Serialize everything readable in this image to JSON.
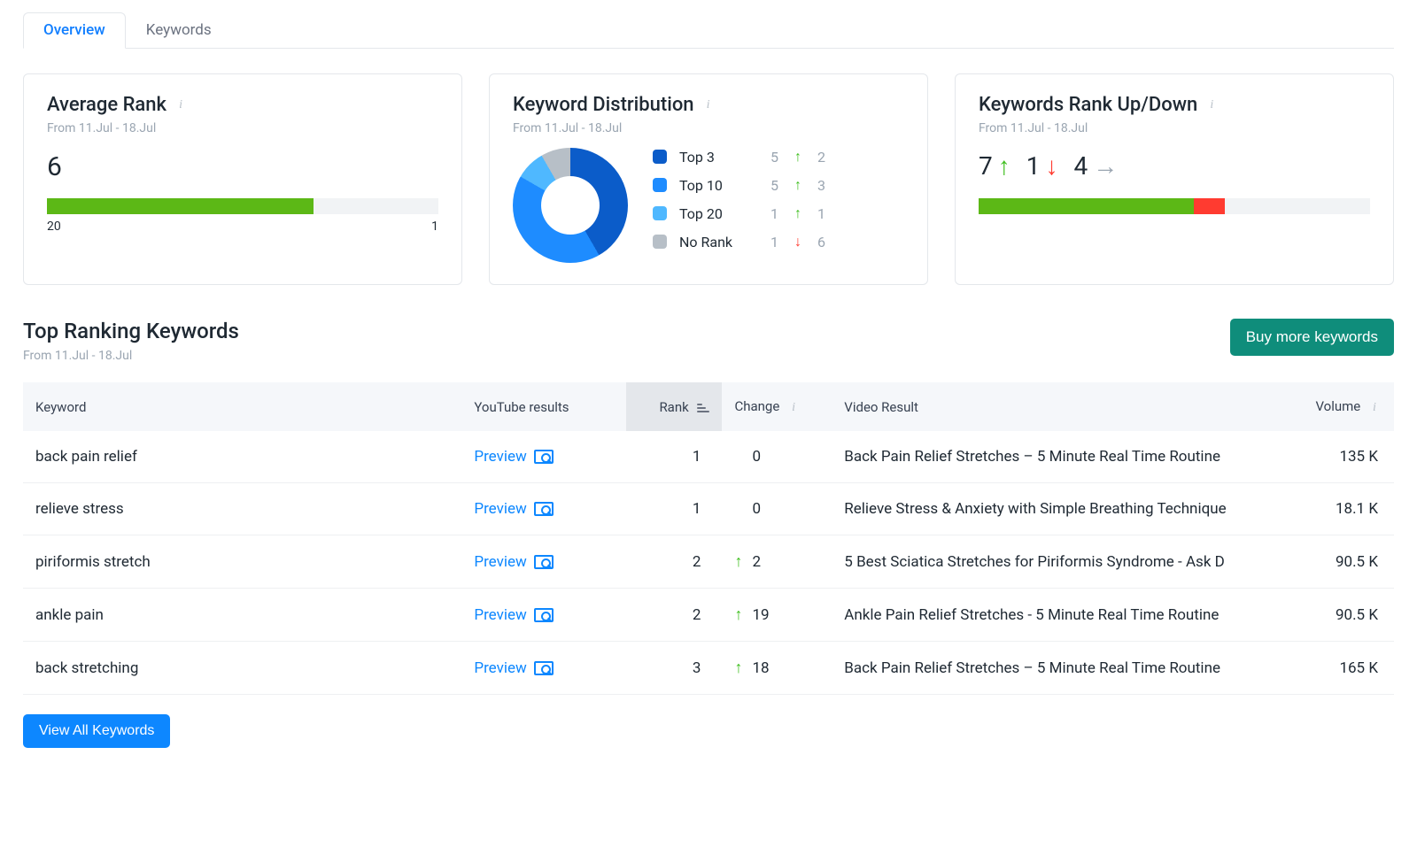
{
  "tabs": {
    "overview": "Overview",
    "keywords": "Keywords"
  },
  "date_range": "From 11.Jul - 18.Jul",
  "cards": {
    "avg_rank": {
      "title": "Average Rank",
      "value": "6",
      "bar_pct": 68,
      "left": "20",
      "right": "1"
    },
    "distribution": {
      "title": "Keyword Distribution",
      "rows": [
        {
          "label": "Top 3",
          "color": "#0b5cc9",
          "count": "5",
          "dir": "up",
          "delta": "2"
        },
        {
          "label": "Top 10",
          "color": "#1e8cff",
          "count": "5",
          "dir": "up",
          "delta": "3"
        },
        {
          "label": "Top 20",
          "color": "#4fb8ff",
          "count": "1",
          "dir": "up",
          "delta": "1"
        },
        {
          "label": "No Rank",
          "color": "#b7bfc7",
          "count": "1",
          "dir": "down",
          "delta": "6"
        }
      ]
    },
    "rank_updown": {
      "title": "Keywords Rank Up/Down",
      "up": "7",
      "down": "1",
      "same": "4",
      "bar": {
        "green": 55,
        "red": 8
      }
    }
  },
  "chart_data": {
    "type": "pie",
    "title": "Keyword Distribution",
    "categories": [
      "Top 3",
      "Top 10",
      "Top 20",
      "No Rank"
    ],
    "values": [
      5,
      5,
      1,
      1
    ],
    "colors": [
      "#0b5cc9",
      "#1e8cff",
      "#4fb8ff",
      "#b7bfc7"
    ]
  },
  "top_keywords": {
    "title": "Top Ranking Keywords",
    "buy_btn": "Buy more keywords",
    "view_all_btn": "View All Keywords",
    "preview_label": "Preview",
    "columns": {
      "keyword": "Keyword",
      "yt": "YouTube results",
      "rank": "Rank",
      "change": "Change",
      "video": "Video Result",
      "volume": "Volume"
    },
    "rows": [
      {
        "keyword": "back pain relief",
        "rank": "1",
        "change": "0",
        "dir": "flat",
        "video": "Back Pain Relief Stretches – 5 Minute Real Time Routine",
        "volume": "135 K"
      },
      {
        "keyword": "relieve stress",
        "rank": "1",
        "change": "0",
        "dir": "flat",
        "video": "Relieve Stress & Anxiety with Simple Breathing Technique",
        "volume": "18.1 K"
      },
      {
        "keyword": "piriformis stretch",
        "rank": "2",
        "change": "2",
        "dir": "up",
        "video": "5 Best Sciatica Stretches for Piriformis Syndrome - Ask D",
        "volume": "90.5 K"
      },
      {
        "keyword": "ankle pain",
        "rank": "2",
        "change": "19",
        "dir": "up",
        "video": "Ankle Pain Relief Stretches - 5 Minute Real Time Routine",
        "volume": "90.5 K"
      },
      {
        "keyword": "back stretching",
        "rank": "3",
        "change": "18",
        "dir": "up",
        "video": "Back Pain Relief Stretches – 5 Minute Real Time Routine",
        "volume": "165 K"
      }
    ]
  }
}
